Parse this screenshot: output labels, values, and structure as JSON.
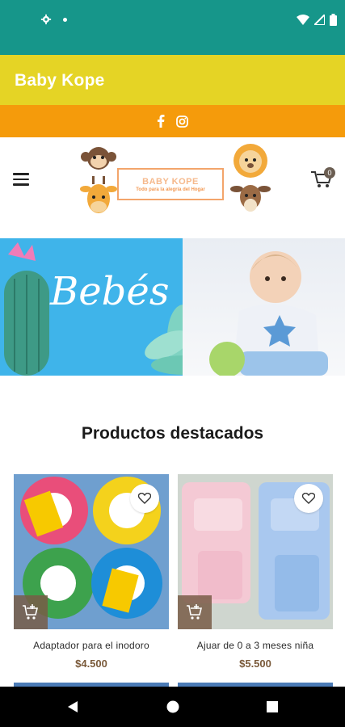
{
  "app": {
    "title": "Baby Kope"
  },
  "logo": {
    "name": "BABY KOPE",
    "tagline": "Todo para la alegría del Hogar"
  },
  "cart": {
    "count": "0"
  },
  "banner": {
    "text": "Bebés"
  },
  "section": {
    "title": "Productos destacados"
  },
  "products": [
    {
      "name": "Adaptador para el inodoro",
      "price": "$4.500"
    },
    {
      "name": "Ajuar de 0 a 3 meses niña",
      "price": "$5.500"
    }
  ],
  "icons": {
    "status_left": [
      "gear-icon",
      "dot-icon"
    ],
    "status_right": [
      "wifi-icon",
      "signal-icon",
      "battery-icon"
    ],
    "social": [
      "facebook-icon",
      "instagram-icon"
    ],
    "nav": [
      "back-icon",
      "home-icon",
      "recents-icon"
    ]
  },
  "colors": {
    "status_bar": "#16968a",
    "app_bar": "#e5d425",
    "social_bar": "#f59b0b",
    "price": "#7a5a3a",
    "add_to_cart": "#785c46"
  }
}
